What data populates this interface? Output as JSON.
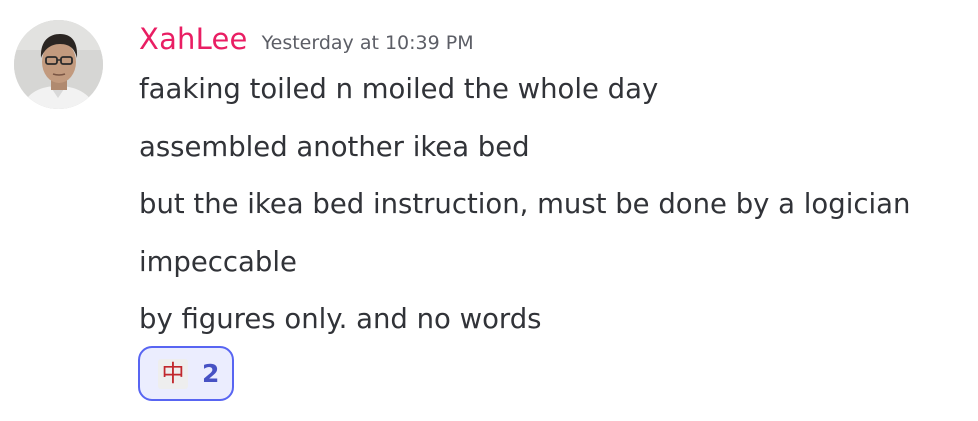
{
  "message": {
    "author": {
      "username": "XahLee",
      "username_color": "#e91e63",
      "avatar_icon": "user-photo-avatar"
    },
    "timestamp": "Yesterday at 10:39 PM",
    "lines": [
      "faaking toiled n moiled the whole day",
      "assembled another ikea bed",
      "but the ikea bed instruction, must be done by a logician",
      "impeccable",
      "by figures only. and no words"
    ],
    "reactions": [
      {
        "emoji": "中",
        "emoji_name": "chinese-character-zhong",
        "count": "2",
        "accent_color": "#5865f2"
      }
    ]
  }
}
